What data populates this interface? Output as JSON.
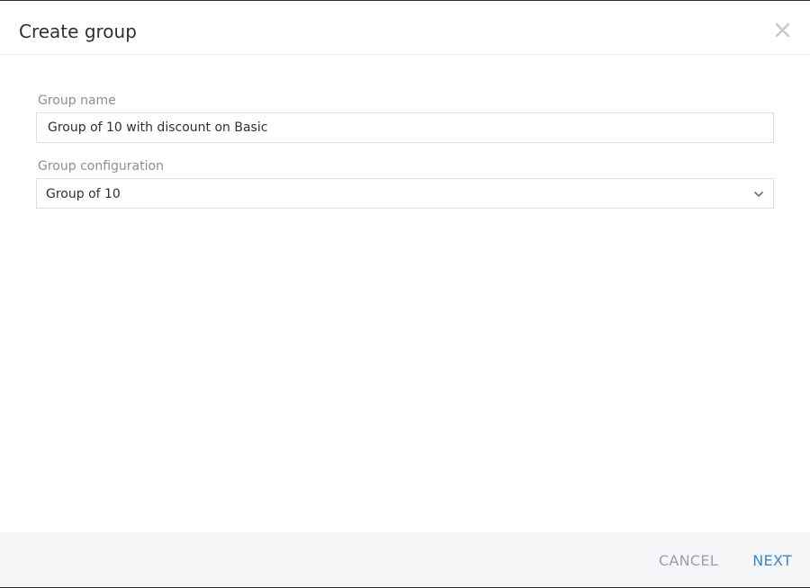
{
  "dialog": {
    "title": "Create group",
    "close_icon": "close-icon"
  },
  "form": {
    "group_name": {
      "label": "Group name",
      "value": "Group of 10 with discount on Basic"
    },
    "group_configuration": {
      "label": "Group configuration",
      "selected": "Group of 10",
      "chevron_icon": "chevron-down-icon"
    }
  },
  "footer": {
    "cancel_label": "CANCEL",
    "next_label": "NEXT"
  },
  "colors": {
    "accent": "#3a86c8",
    "muted_button": "#9aa0a6",
    "footer_bg": "#f5f6f8"
  }
}
